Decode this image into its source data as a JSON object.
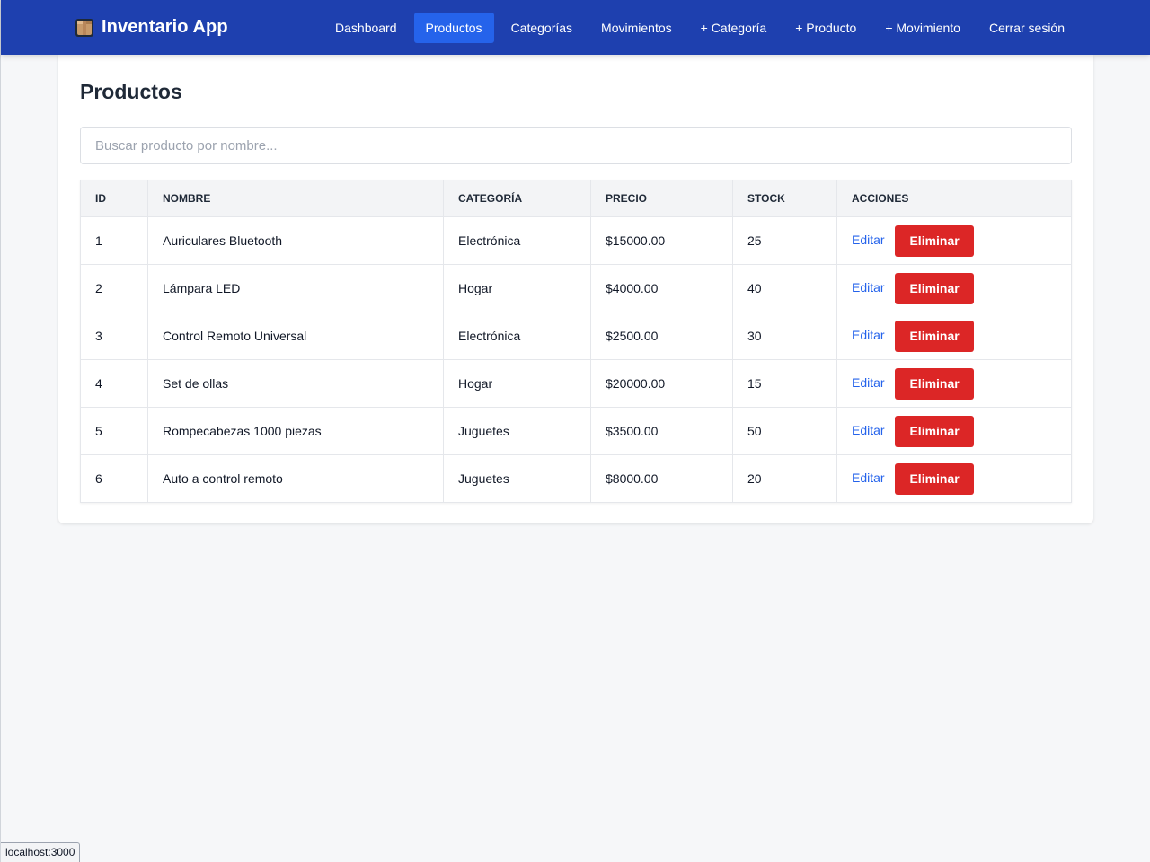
{
  "navbar": {
    "brand": "Inventario App",
    "brand_icon": "box-icon",
    "links": [
      {
        "label": "Dashboard",
        "active": false
      },
      {
        "label": "Productos",
        "active": true
      },
      {
        "label": "Categorías",
        "active": false
      },
      {
        "label": "Movimientos",
        "active": false
      },
      {
        "label": "+ Categoría",
        "active": false
      },
      {
        "label": "+ Producto",
        "active": false
      },
      {
        "label": "+ Movimiento",
        "active": false
      },
      {
        "label": "Cerrar sesión",
        "active": false
      }
    ],
    "color": "#1e40af",
    "active_color": "#2563eb"
  },
  "main": {
    "title": "Productos",
    "search": {
      "placeholder": "Buscar producto por nombre...",
      "value": ""
    },
    "table": {
      "headers": [
        "ID",
        "NOMBRE",
        "CATEGORÍA",
        "PRECIO",
        "STOCK",
        "ACCIONES"
      ],
      "rows": [
        {
          "id": "1",
          "nombre": "Auriculares Bluetooth",
          "categoria": "Electrónica",
          "precio": "$15000.00",
          "stock": "25"
        },
        {
          "id": "2",
          "nombre": "Lámpara LED",
          "categoria": "Hogar",
          "precio": "$4000.00",
          "stock": "40"
        },
        {
          "id": "3",
          "nombre": "Control Remoto Universal",
          "categoria": "Electrónica",
          "precio": "$2500.00",
          "stock": "30"
        },
        {
          "id": "4",
          "nombre": "Set de ollas",
          "categoria": "Hogar",
          "precio": "$20000.00",
          "stock": "15"
        },
        {
          "id": "5",
          "nombre": "Rompecabezas 1000 piezas",
          "categoria": "Juguetes",
          "precio": "$3500.00",
          "stock": "50"
        },
        {
          "id": "6",
          "nombre": "Auto a control remoto",
          "categoria": "Juguetes",
          "precio": "$8000.00",
          "stock": "20"
        }
      ],
      "edit_label": "Editar",
      "delete_label": "Eliminar",
      "delete_color": "#dc2626",
      "edit_color": "#2563eb"
    }
  },
  "status_bar": {
    "url": "localhost:3000"
  }
}
